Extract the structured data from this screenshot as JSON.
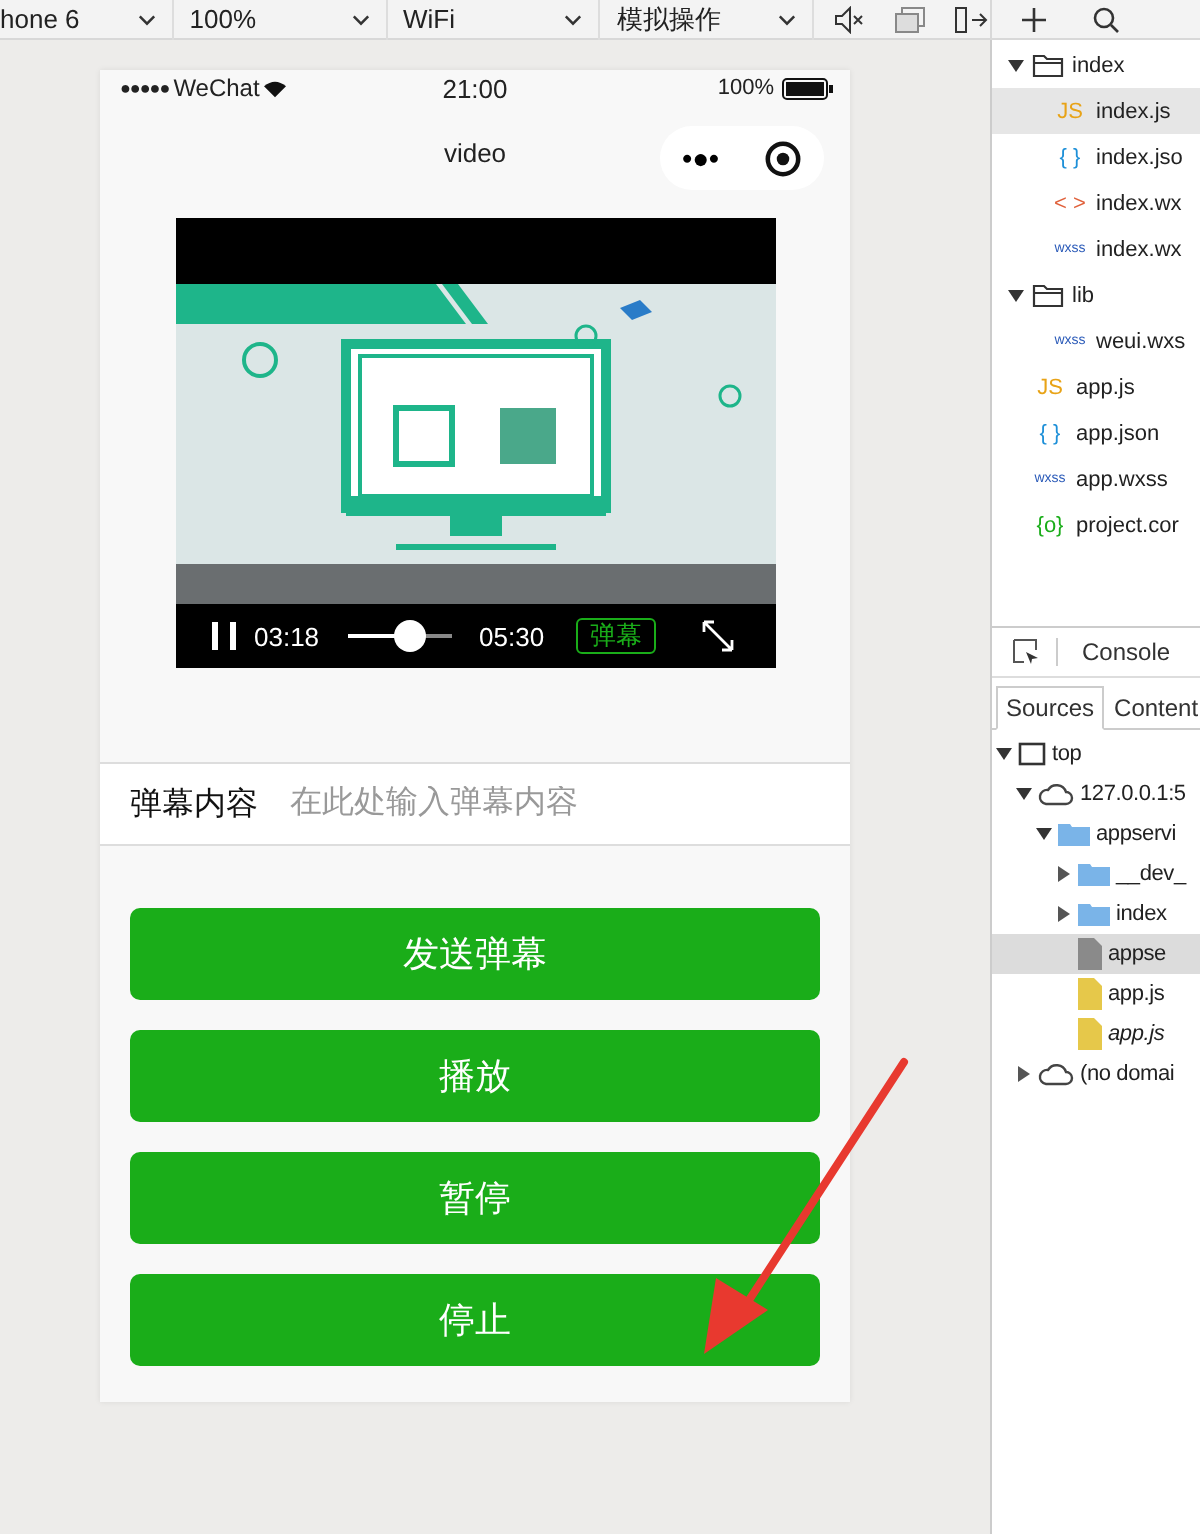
{
  "toolbar": {
    "dropdowns": [
      {
        "label": "hone 6"
      },
      {
        "label": "100%"
      },
      {
        "label": "WiFi"
      },
      {
        "label": "模拟操作"
      }
    ]
  },
  "phone": {
    "status_bar": {
      "signal": "●●●●●",
      "carrier": "WeChat",
      "time": "21:00",
      "battery": "100%"
    },
    "nav": {
      "title": "video",
      "menu": "•●•"
    },
    "video": {
      "playing": true,
      "current_time": "03:18",
      "level": 0.6,
      "duration": "05:30",
      "danmu_button": "弹幕"
    },
    "danmu_input": {
      "label": "弹幕内容",
      "placeholder": "在此处输入弹幕内容"
    },
    "buttons": [
      {
        "label": "发送弹幕"
      },
      {
        "label": "播放"
      },
      {
        "label": "暂停"
      },
      {
        "label": "停止"
      }
    ]
  },
  "files": [
    {
      "name": "index",
      "kind": "folder",
      "expanded": true,
      "selected": false,
      "children": [
        {
          "name": "index.js",
          "kind": "file",
          "badge": "JS",
          "color": "#e8a317",
          "selected": true
        },
        {
          "name": "index.jso",
          "kind": "file",
          "badge": "{ }",
          "color": "#1e90d8",
          "selected": false
        },
        {
          "name": "index.wx",
          "kind": "file",
          "badge": "< >",
          "color": "#e0603a",
          "selected": false
        },
        {
          "name": "index.wx",
          "kind": "file",
          "badge": "wxss",
          "color": "#2a5ab8",
          "selected": false
        }
      ]
    },
    {
      "name": "lib",
      "kind": "folder",
      "expanded": true,
      "selected": false,
      "children": [
        {
          "name": "weui.wxs",
          "kind": "file",
          "badge": "wxss",
          "color": "#2a5ab8",
          "selected": false
        }
      ]
    },
    {
      "name": "app.js",
      "kind": "file",
      "badge": "JS",
      "color": "#e8a317",
      "selected": false
    },
    {
      "name": "app.json",
      "kind": "file",
      "badge": "{ }",
      "color": "#1e90d8",
      "selected": false
    },
    {
      "name": "app.wxss",
      "kind": "file",
      "badge": "wxss",
      "color": "#2a5ab8",
      "selected": false
    },
    {
      "name": "project.cor",
      "kind": "file",
      "badge": "{o}",
      "color": "#1aad19",
      "selected": false
    }
  ],
  "devtools": {
    "console_tab": "Console",
    "tabs": [
      {
        "label": "Sources",
        "selected": true
      },
      {
        "label": "Content",
        "selected": false
      }
    ],
    "tree": [
      {
        "name": "top",
        "kind": "frame",
        "expanded": true,
        "selected": false,
        "children": [
          {
            "name": "127.0.0.1:5",
            "kind": "origin",
            "expanded": true,
            "selected": false,
            "children": [
              {
                "name": "appservi",
                "kind": "folder",
                "expanded": true,
                "selected": false,
                "children": [
                  {
                    "name": "__dev_",
                    "kind": "folder",
                    "expanded": false,
                    "selected": false
                  },
                  {
                    "name": "index",
                    "kind": "folder",
                    "expanded": false,
                    "selected": false
                  },
                  {
                    "name": "appse",
                    "kind": "gray-file",
                    "selected": true
                  },
                  {
                    "name": "app.js",
                    "kind": "yellow-file",
                    "selected": false
                  },
                  {
                    "name": "app.js",
                    "kind": "yellow-file",
                    "italic": true,
                    "selected": false
                  }
                ]
              }
            ]
          },
          {
            "name": "(no domai",
            "kind": "origin",
            "expanded": false,
            "selected": false
          }
        ]
      }
    ]
  }
}
